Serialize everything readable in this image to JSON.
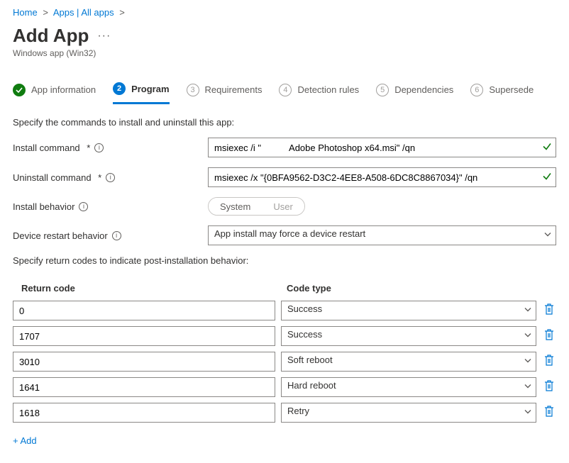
{
  "breadcrumb": {
    "items": [
      {
        "label": "Home"
      },
      {
        "label": "Apps | All apps"
      }
    ]
  },
  "page": {
    "title": "Add App",
    "subtitle": "Windows app (Win32)"
  },
  "tabs": [
    {
      "num": "",
      "label": "App information",
      "state": "done"
    },
    {
      "num": "2",
      "label": "Program",
      "state": "active"
    },
    {
      "num": "3",
      "label": "Requirements",
      "state": "future"
    },
    {
      "num": "4",
      "label": "Detection rules",
      "state": "future"
    },
    {
      "num": "5",
      "label": "Dependencies",
      "state": "future"
    },
    {
      "num": "6",
      "label": "Supersede",
      "state": "future"
    }
  ],
  "section": {
    "intro": "Specify the commands to install and uninstall this app:",
    "install_label": "Install command",
    "install_value": "msiexec /i \"           Adobe Photoshop x64.msi\" /qn",
    "uninstall_label": "Uninstall command",
    "uninstall_value": "msiexec /x \"{0BFA9562-D3C2-4EE8-A508-6DC8C8867034}\" /qn",
    "behavior_label": "Install behavior",
    "behavior_system": "System",
    "behavior_user": "User",
    "restart_label": "Device restart behavior",
    "restart_value": "App install may force a device restart",
    "rc_intro": "Specify return codes to indicate post-installation behavior:",
    "rc_header_code": "Return code",
    "rc_header_type": "Code type",
    "add_label": "+ Add"
  },
  "return_codes": [
    {
      "code": "0",
      "type": "Success"
    },
    {
      "code": "1707",
      "type": "Success"
    },
    {
      "code": "3010",
      "type": "Soft reboot"
    },
    {
      "code": "1641",
      "type": "Hard reboot"
    },
    {
      "code": "1618",
      "type": "Retry"
    }
  ]
}
